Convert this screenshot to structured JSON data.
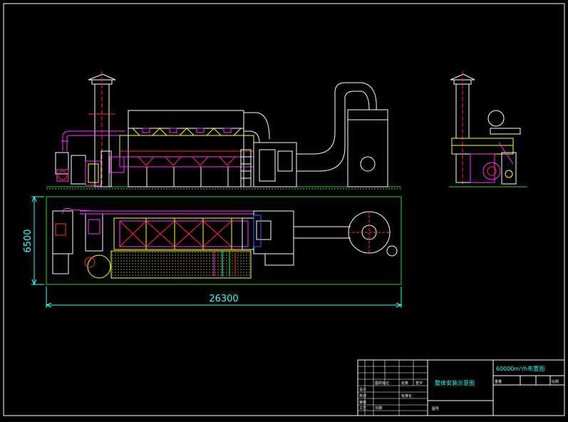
{
  "drawing": {
    "width_dim": "26300",
    "height_dim": "6500"
  },
  "title_block": {
    "drawing_title": "整体安装示意图",
    "spec": "60000m³/h布置图",
    "sheet_label": "图号",
    "cells": [
      "设计",
      "校对",
      "审核",
      "工艺",
      "日期",
      "比例",
      "重量",
      "共 张",
      "第 张",
      "材料",
      "数量",
      "图样标记",
      "处数",
      "更改文件号",
      "签字",
      "标准化"
    ]
  },
  "colors": {
    "frame": "#ffffff",
    "equipment": "#ffffff",
    "duct": "#ff33ff",
    "chimney": "#ffffff",
    "centerline": "#ff3333",
    "filter": "#ffff33",
    "blue": "#3366ff",
    "cyan": "#33ffff",
    "green": "#33ff33",
    "ground": "#33cc33",
    "dimension": "#33ffff"
  }
}
